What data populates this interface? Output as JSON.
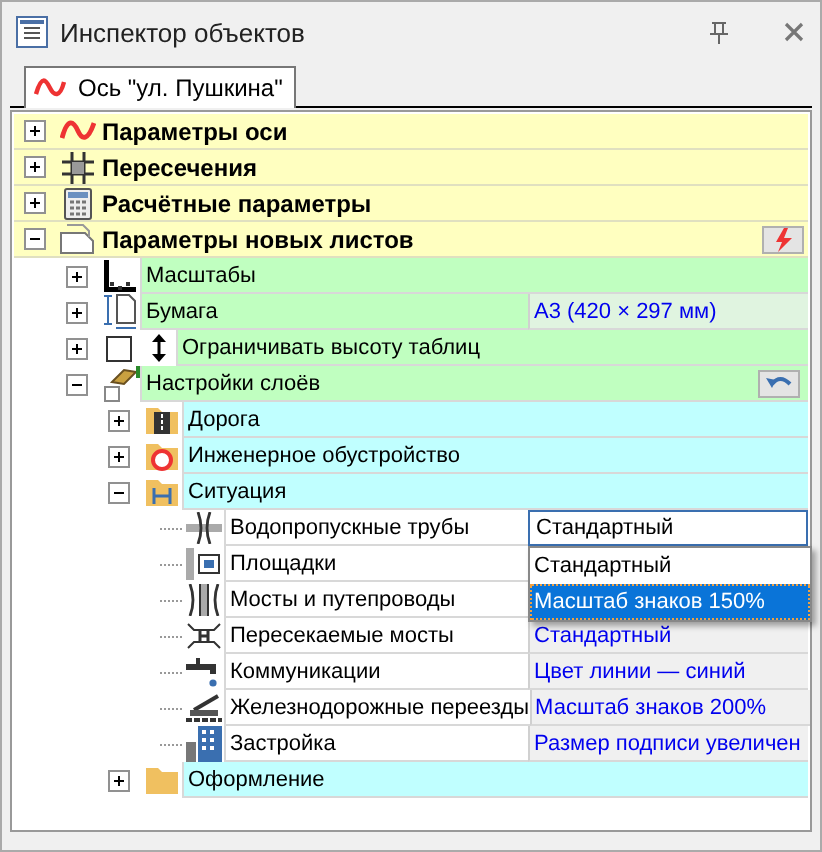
{
  "window": {
    "title": "Инспектор объектов"
  },
  "tabs": [
    {
      "label": "Ось \"ул. Пушкина\"",
      "selected": true
    }
  ],
  "tree": [
    {
      "label": "Параметры оси",
      "kind": "section",
      "expanded": false
    },
    {
      "label": "Пересечения",
      "kind": "section",
      "expanded": false
    },
    {
      "label": "Расчётные параметры",
      "kind": "section",
      "expanded": false
    },
    {
      "label": "Параметры новых листов",
      "kind": "section",
      "expanded": true,
      "tool_button": true,
      "children": [
        {
          "label": "Масштабы",
          "kind": "group",
          "expanded": false
        },
        {
          "label": "Бумага",
          "kind": "group",
          "expanded": false,
          "value": "А3 (420 × 297 мм)"
        },
        {
          "label": "Ограничивать высоту таблиц",
          "kind": "checkbox",
          "expanded": false,
          "checked": false
        },
        {
          "label": "Настройки слоёв",
          "kind": "group",
          "expanded": true,
          "tool_button": true,
          "children": [
            {
              "label": "Дорога",
              "kind": "group",
              "expanded": false
            },
            {
              "label": "Инженерное обустройство",
              "kind": "group",
              "expanded": false
            },
            {
              "label": "Ситуация",
              "kind": "group",
              "expanded": true,
              "children": [
                {
                  "label": "Водопропускные трубы",
                  "value": "Стандартный",
                  "dropdown": {
                    "open": true,
                    "options": [
                      {
                        "label": "Стандартный",
                        "selected": false
                      },
                      {
                        "label": "Масштаб знаков 150%",
                        "selected": true
                      }
                    ]
                  }
                },
                {
                  "label": "Площадки"
                },
                {
                  "label": "Мосты и путепроводы"
                },
                {
                  "label": "Пересекаемые мосты",
                  "value": "Стандартный"
                },
                {
                  "label": "Коммуникации",
                  "value": "Цвет линии — синий"
                },
                {
                  "label": "Железнодорожные переезды",
                  "value": "Масштаб знаков 200%"
                },
                {
                  "label": "Застройка",
                  "value": "Размер подписи увеличен"
                }
              ]
            },
            {
              "label": "Оформление",
              "kind": "group",
              "expanded": false
            }
          ]
        }
      ]
    }
  ]
}
